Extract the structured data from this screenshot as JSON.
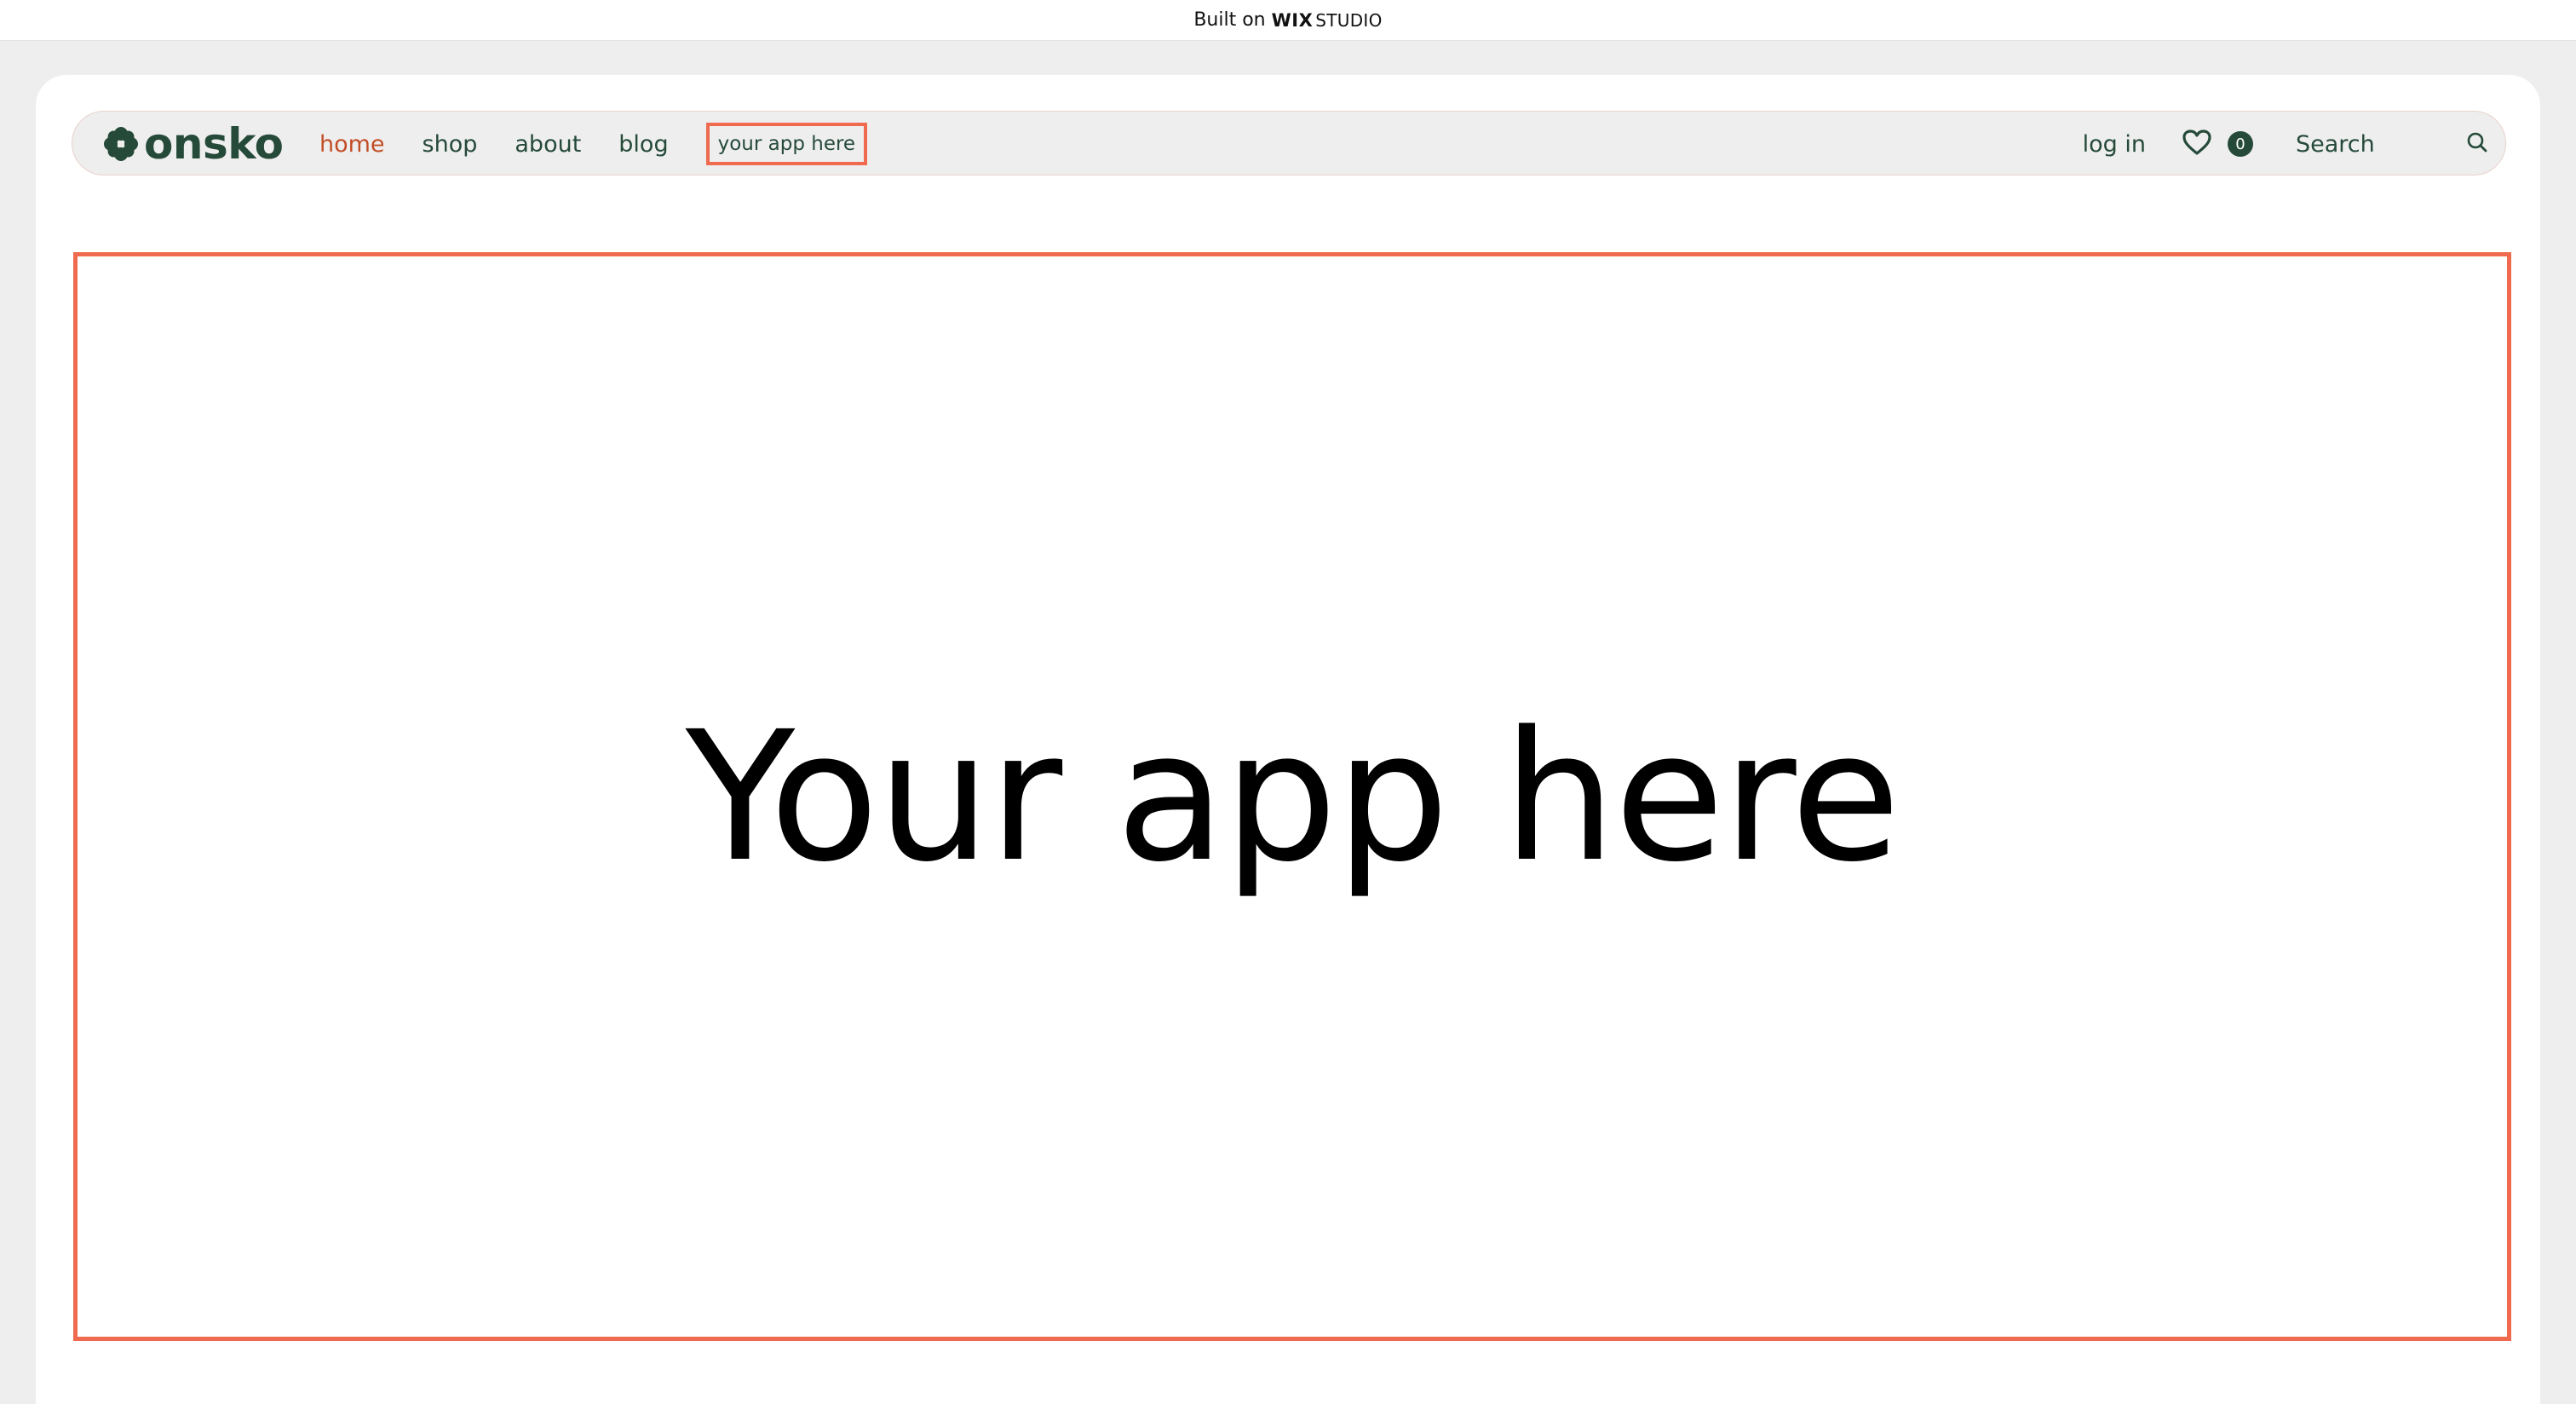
{
  "wix_banner": {
    "prefix": "Built on",
    "brand": "WIX",
    "product": "STUDIO"
  },
  "header": {
    "logo_text": "onsko",
    "nav": [
      {
        "label": "home",
        "active": true
      },
      {
        "label": "shop"
      },
      {
        "label": "about"
      },
      {
        "label": "blog"
      },
      {
        "label": "your app here",
        "highlighted": true
      }
    ],
    "login_label": "log in",
    "wishlist_count": "0",
    "search_label": "Search"
  },
  "main": {
    "app_title": "Your app here"
  },
  "colors": {
    "brand_green": "#254a3a",
    "accent_orange": "#ef6a4f",
    "active_nav": "#c24e27",
    "header_bg": "#eeeeee"
  }
}
